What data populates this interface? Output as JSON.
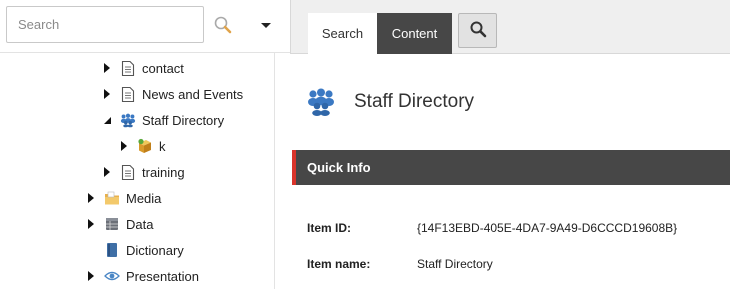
{
  "search": {
    "placeholder": "Search",
    "value": ""
  },
  "tree": {
    "items": [
      {
        "label": "contact",
        "icon": "document-icon",
        "expander": "collapsed"
      },
      {
        "label": "News and Events",
        "icon": "document-icon",
        "expander": "collapsed"
      },
      {
        "label": "Staff Directory",
        "icon": "people-icon",
        "expander": "expanded",
        "selected": true
      },
      {
        "label": "k",
        "icon": "package-icon",
        "expander": "collapsed"
      },
      {
        "label": "training",
        "icon": "document-icon",
        "expander": "collapsed"
      },
      {
        "label": "Media",
        "icon": "folder-icon",
        "expander": "collapsed"
      },
      {
        "label": "Data",
        "icon": "data-icon",
        "expander": "collapsed"
      },
      {
        "label": "Dictionary",
        "icon": "book-icon",
        "expander": "none"
      },
      {
        "label": "Presentation",
        "icon": "eye-icon",
        "expander": "collapsed"
      }
    ]
  },
  "tabs": {
    "search_label": "Search",
    "content_label": "Content",
    "active": "Content"
  },
  "item": {
    "title": "Staff Directory",
    "icon": "people-icon"
  },
  "quick_info": {
    "title": "Quick Info",
    "rows": [
      {
        "label": "Item ID:",
        "value": "{14F13EBD-405E-4DA7-9A49-D6CCCD19608B}"
      },
      {
        "label": "Item name:",
        "value": "Staff Directory"
      }
    ]
  },
  "colors": {
    "accent_red": "#d9342b",
    "dark_bar": "#474747",
    "selection": "#d6e8f6",
    "people_icon": "#3b79c3"
  }
}
